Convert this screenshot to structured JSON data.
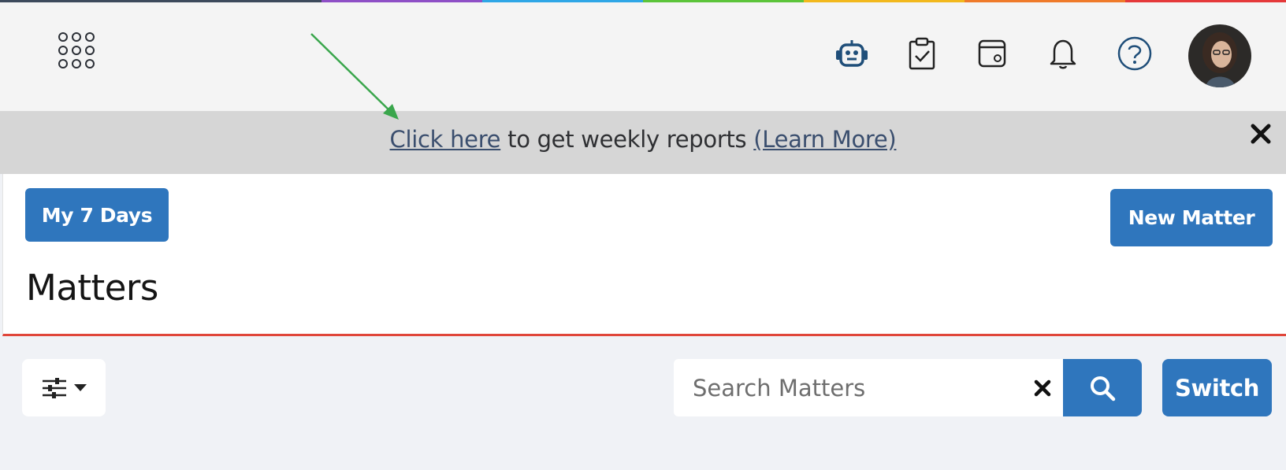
{
  "topbar": {
    "rainbow_colors": [
      "#3d4a5c",
      "#8e4fc6",
      "#2ea6e6",
      "#5cc43a",
      "#f2b81c",
      "#ef7a2a",
      "#e5393a"
    ],
    "icons": [
      "apps-grid-icon",
      "robot-icon",
      "tasks-clipboard-icon",
      "calendar-icon",
      "bell-icon",
      "help-icon"
    ]
  },
  "banner": {
    "link_text": "Click here",
    "middle_text": " to get weekly reports ",
    "learn_more": "(Learn More)"
  },
  "header": {
    "my7days_label": "My 7 Days",
    "new_matter_label": "New Matter",
    "title": "Matters"
  },
  "search": {
    "placeholder": "Search Matters",
    "value": ""
  },
  "switch_label": "Switch",
  "colors": {
    "accent": "#2f76bd",
    "underline_red": "#e0463a",
    "arrow_green": "#3aa64c"
  }
}
